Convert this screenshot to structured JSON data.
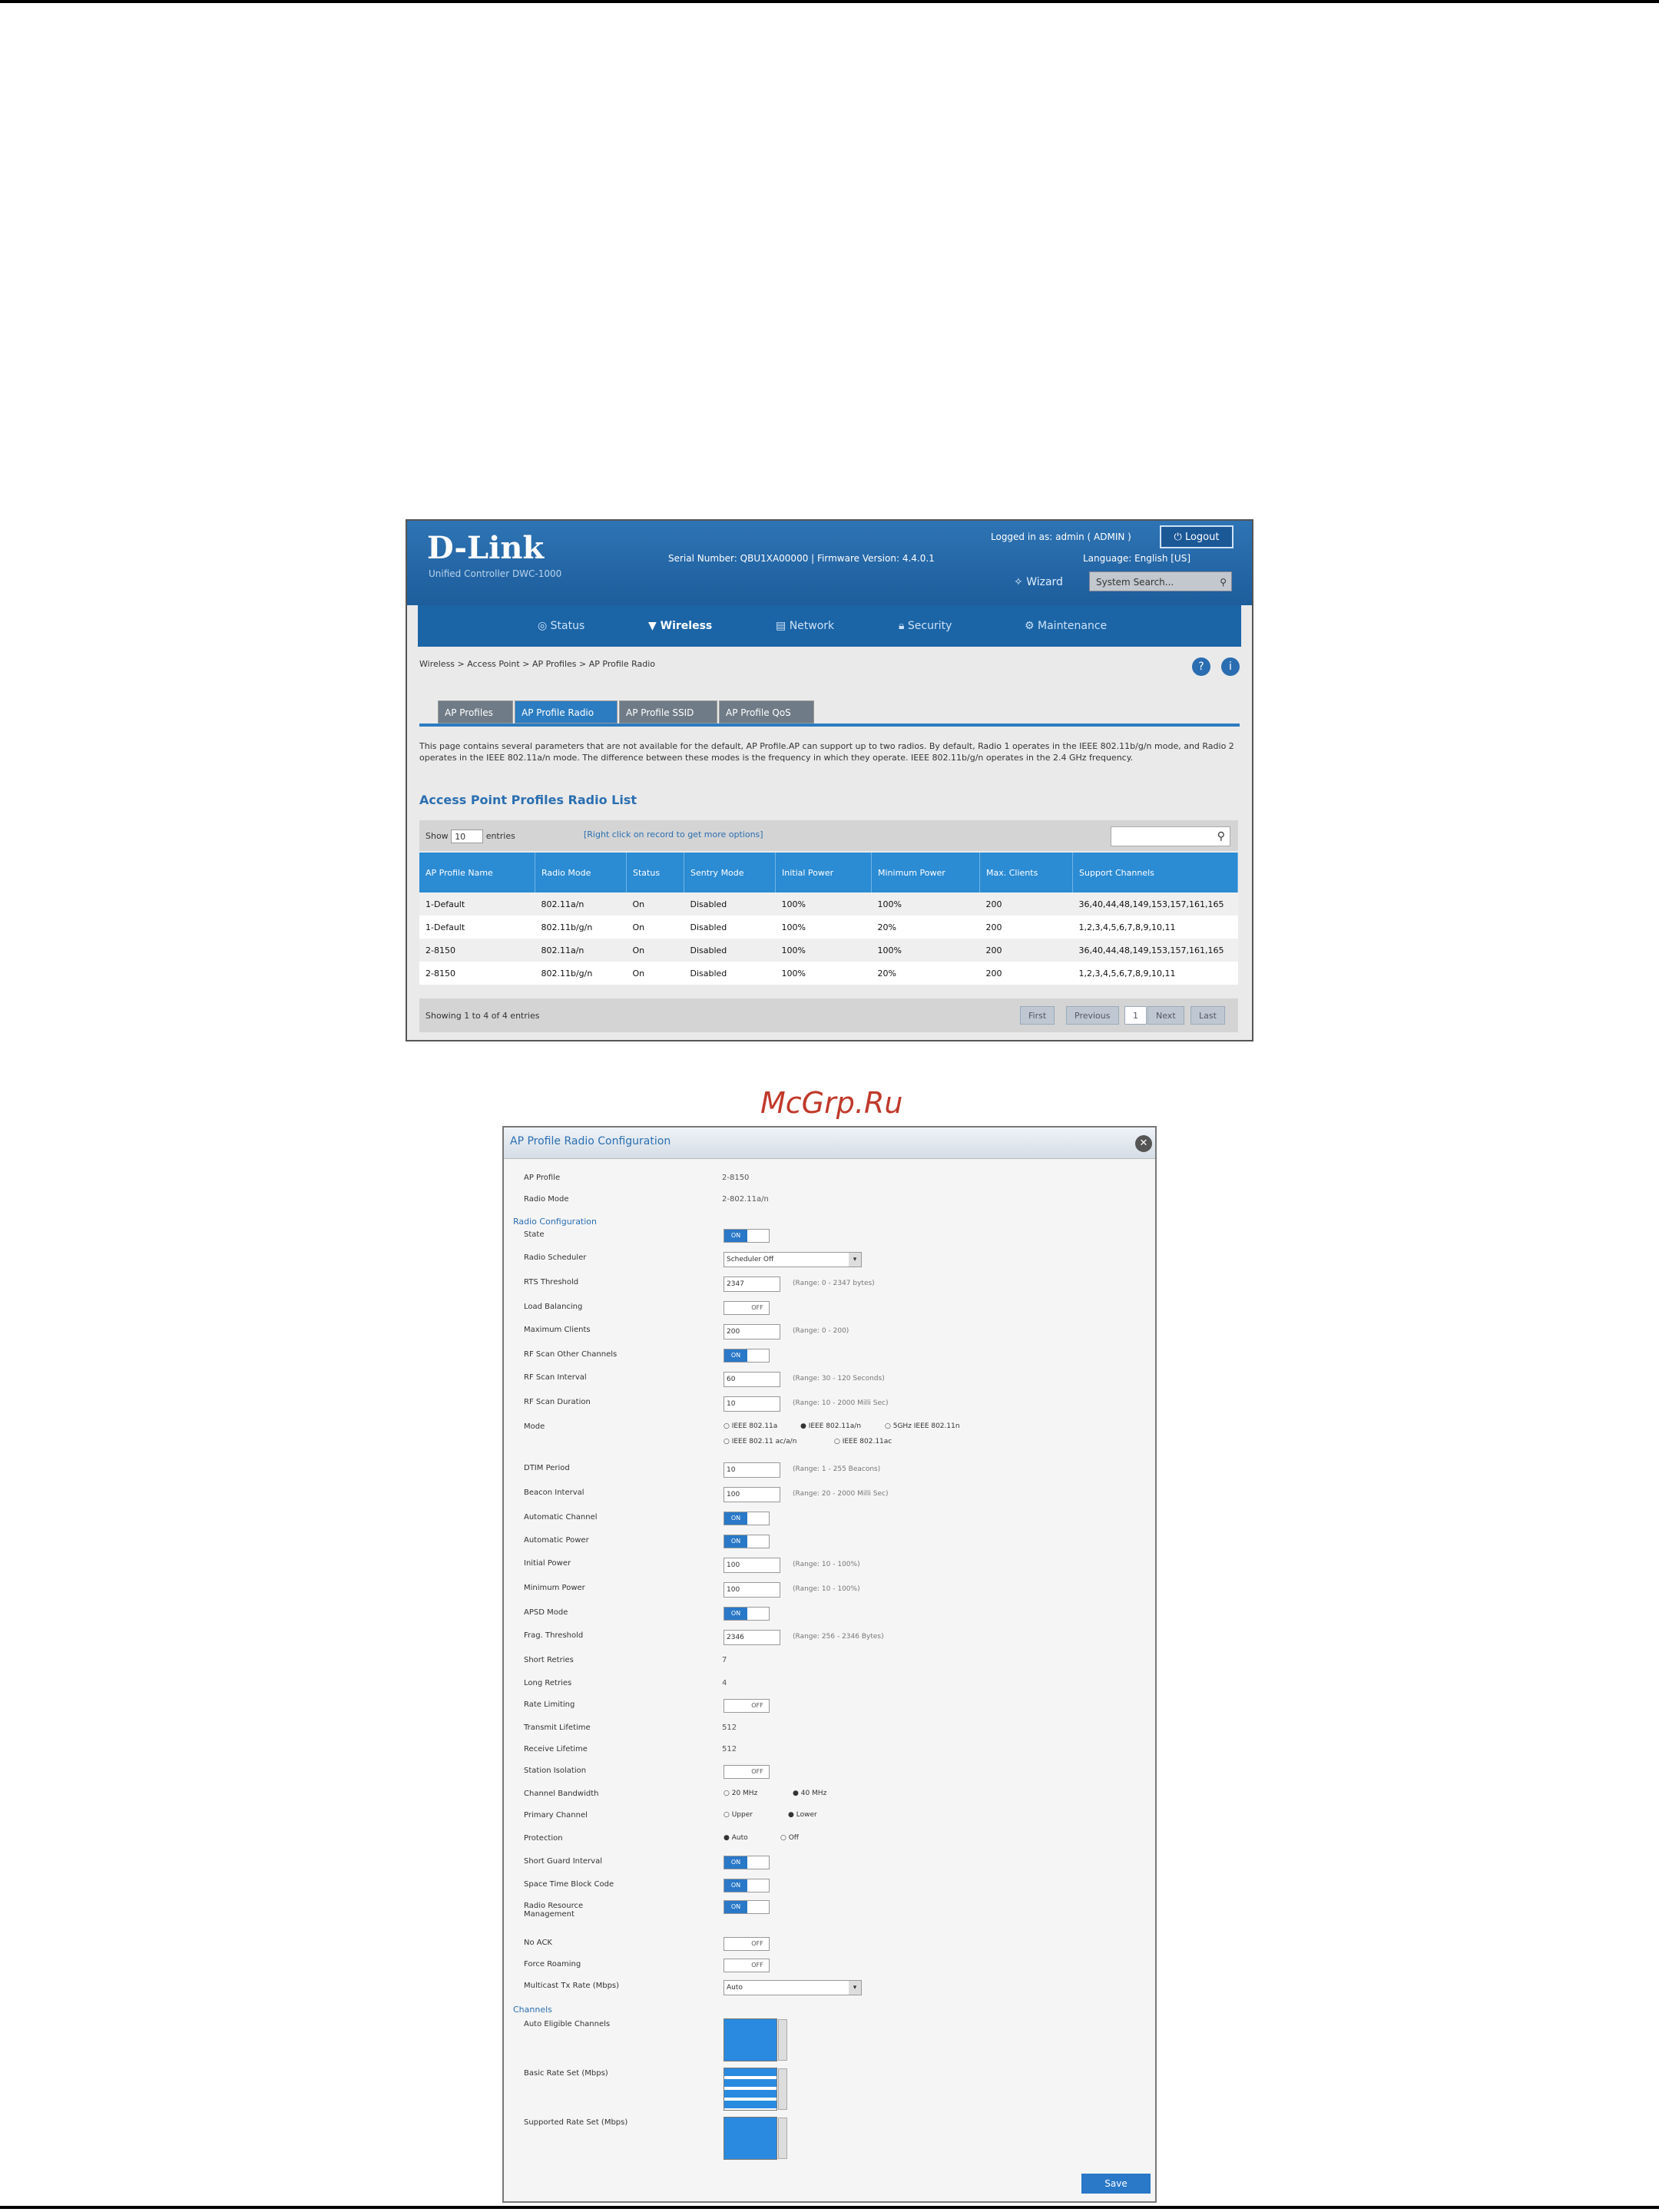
{
  "watermark": "McGrp.Ru",
  "header": {
    "brand": "D-Link",
    "subtitle": "Unified Controller  DWC-1000",
    "serial_label": "Serial Number:",
    "serial_value": "QBU1XA00000",
    "firmware_label": "Firmware Version:",
    "firmware_value": "4.4.0.1",
    "logged_in_label": "Logged in as:",
    "logged_in_user": "admin",
    "logged_in_role": "ADMIN",
    "logout_label": "Logout",
    "language_label": "Language:",
    "language_value": "English [US]",
    "wizard_label": "Wizard",
    "system_search_placeholder": "System Search..."
  },
  "nav": {
    "items": [
      {
        "label": "Status",
        "icon": "status-icon"
      },
      {
        "label": "Wireless",
        "icon": "wireless-icon"
      },
      {
        "label": "Network",
        "icon": "network-icon"
      },
      {
        "label": "Security",
        "icon": "lock-icon"
      },
      {
        "label": "Maintenance",
        "icon": "gear-icon"
      }
    ],
    "active": "Wireless"
  },
  "breadcrumb": [
    "Wireless",
    "Access Point",
    "AP Profiles",
    "AP Profile Radio"
  ],
  "tabs": [
    "AP Profiles",
    "AP Profile Radio",
    "AP Profile SSID",
    "AP Profile QoS"
  ],
  "active_tab": "AP Profile Radio",
  "description": "This page contains several parameters that are not available for the default, AP Profile.AP can support up to two radios. By default, Radio 1 operates in the IEEE 802.11b/g/n mode, and Radio 2 operates in the IEEE 802.11a/n mode. The difference between these modes is the frequency in which they operate. IEEE 802.11b/g/n operates in the 2.4 GHz frequency.",
  "list": {
    "title": "Access Point Profiles Radio List",
    "show_label": "Show",
    "show_value": "10",
    "entries_label": "entries",
    "hint": "[Right click on record to get more options]",
    "columns": [
      "AP Profile Name",
      "Radio Mode",
      "Status",
      "Sentry Mode",
      "Initial Power",
      "Minimum Power",
      "Max. Clients",
      "Support Channels"
    ],
    "rows": [
      [
        "1-Default",
        "802.11a/n",
        "On",
        "Disabled",
        "100%",
        "100%",
        "200",
        "36,40,44,48,149,153,157,161,165"
      ],
      [
        "1-Default",
        "802.11b/g/n",
        "On",
        "Disabled",
        "100%",
        "20%",
        "200",
        "1,2,3,4,5,6,7,8,9,10,11"
      ],
      [
        "2-8150",
        "802.11a/n",
        "On",
        "Disabled",
        "100%",
        "100%",
        "200",
        "36,40,44,48,149,153,157,161,165"
      ],
      [
        "2-8150",
        "802.11b/g/n",
        "On",
        "Disabled",
        "100%",
        "20%",
        "200",
        "1,2,3,4,5,6,7,8,9,10,11"
      ]
    ],
    "showing": "Showing 1 to 4 of 4 entries",
    "pager": [
      "First",
      "Previous",
      "1",
      "Next",
      "Last"
    ]
  },
  "dialog": {
    "title": "AP Profile Radio Configuration",
    "fields": {
      "ap_profile_label": "AP Profile",
      "ap_profile_value": "2-8150",
      "radio_mode_label": "Radio Mode",
      "radio_mode_value": "2-802.11a/n",
      "radio_configuration": "Radio Configuration",
      "state": "State",
      "radio_scheduler": "Radio Scheduler",
      "radio_scheduler_value": "Scheduler Off",
      "rts_threshold": "RTS Threshold",
      "rts_value": "2347",
      "rts_range": "(Range: 0 - 2347 bytes)",
      "load_balancing": "Load Balancing",
      "maximum_clients": "Maximum Clients",
      "max_clients_value": "200",
      "max_clients_range": "(Range: 0 - 200)",
      "rf_scan_other": "RF Scan Other Channels",
      "rf_scan_interval": "RF Scan Interval",
      "rf_scan_interval_value": "60",
      "rf_scan_interval_range": "(Range: 30 - 120 Seconds)",
      "rf_scan_duration": "RF Scan Duration",
      "rf_scan_duration_value": "10",
      "rf_scan_duration_range": "(Range: 10 - 2000 Milli Sec)",
      "mode": "Mode",
      "mode_options": [
        "IEEE 802.11a",
        "IEEE 802.11a/n",
        "5GHz IEEE 802.11n",
        "IEEE 802.11 ac/a/n",
        "IEEE 802.11ac"
      ],
      "dtim_period": "DTIM Period",
      "dtim_value": "10",
      "dtim_range": "(Range: 1 - 255 Beacons)",
      "beacon_interval": "Beacon Interval",
      "beacon_value": "100",
      "beacon_range": "(Range: 20 - 2000 Milli Sec)",
      "automatic_channel": "Automatic Channel",
      "automatic_power": "Automatic Power",
      "initial_power": "Initial Power",
      "initial_power_value": "100",
      "initial_power_range": "(Range: 10 - 100%)",
      "minimum_power": "Minimum Power",
      "minimum_power_value": "100",
      "minimum_power_range": "(Range: 10 - 100%)",
      "apsd_mode": "APSD Mode",
      "frag_threshold": "Frag. Threshold",
      "frag_value": "2346",
      "frag_range": "(Range: 256 - 2346 Bytes)",
      "short_retries": "Short Retries",
      "short_retries_value": "7",
      "long_retries": "Long Retries",
      "long_retries_value": "4",
      "rate_limiting": "Rate Limiting",
      "transmit_lifetime": "Transmit Lifetime",
      "transmit_lifetime_value": "512",
      "receive_lifetime": "Receive Lifetime",
      "receive_lifetime_value": "512",
      "station_isolation": "Station Isolation",
      "channel_bandwidth": "Channel Bandwidth",
      "bw_options": [
        "20 MHz",
        "40 MHz"
      ],
      "primary_channel": "Primary Channel",
      "primary_options": [
        "Upper",
        "Lower"
      ],
      "protection": "Protection",
      "protection_options": [
        "Auto",
        "Off"
      ],
      "short_guard": "Short Guard Interval",
      "stbc": "Space Time Block Code",
      "rrm": "Radio Resource Management",
      "no_ack": "No ACK",
      "force_roaming": "Force Roaming",
      "multicast_rate": "Multicast Tx Rate (Mbps)",
      "multicast_value": "Auto",
      "channels": "Channels",
      "auto_eligible": "Auto Eligible Channels",
      "basic_rate": "Basic Rate Set (Mbps)",
      "supported_rate": "Supported Rate Set (Mbps)",
      "on": "ON",
      "off": "OFF",
      "save": "Save"
    }
  }
}
